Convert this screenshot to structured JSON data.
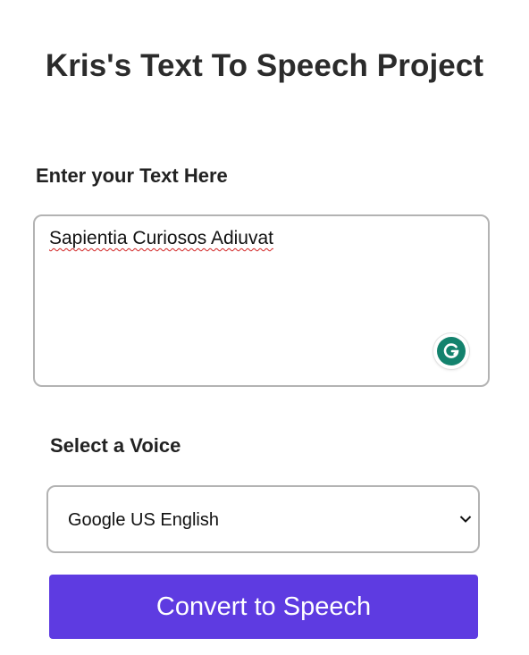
{
  "page": {
    "title": "Kris's Text To Speech Project"
  },
  "text_input": {
    "label": "Enter your Text Here",
    "value": "Sapientia Curiosos Adiuvat",
    "spellcheck_underlined_words": [
      "Sapientia",
      "Adiuvat"
    ]
  },
  "grammarly": {
    "icon": "grammarly-g-icon",
    "color": "#13826d"
  },
  "voice_select": {
    "label": "Select a Voice",
    "selected": "Google US English",
    "icon": "chevron-down-icon"
  },
  "convert_button": {
    "label": "Convert to Speech",
    "color": "#5e3be1"
  }
}
